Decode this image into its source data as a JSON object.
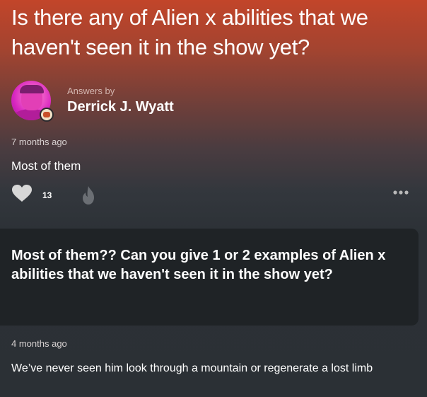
{
  "question": {
    "title": "Is there any of Alien x abilities that we haven't seen it in the show yet?"
  },
  "answer": {
    "answers_by_label": "Answers by",
    "author_name": "Derrick J. Wyatt",
    "timestamp": "7 months ago",
    "text": "Most of them",
    "like_count": "13"
  },
  "comment": {
    "text": "Most of them?? Can you give 1 or 2 examples of Alien x abilities that we haven't seen it in the show yet?"
  },
  "reply": {
    "timestamp": "4 months ago",
    "text": "We’ve never seen him look through a mountain or regenerate a lost limb"
  },
  "icons": {
    "like": "heart-icon",
    "fire": "fire-icon",
    "more": "more-dots-icon"
  }
}
